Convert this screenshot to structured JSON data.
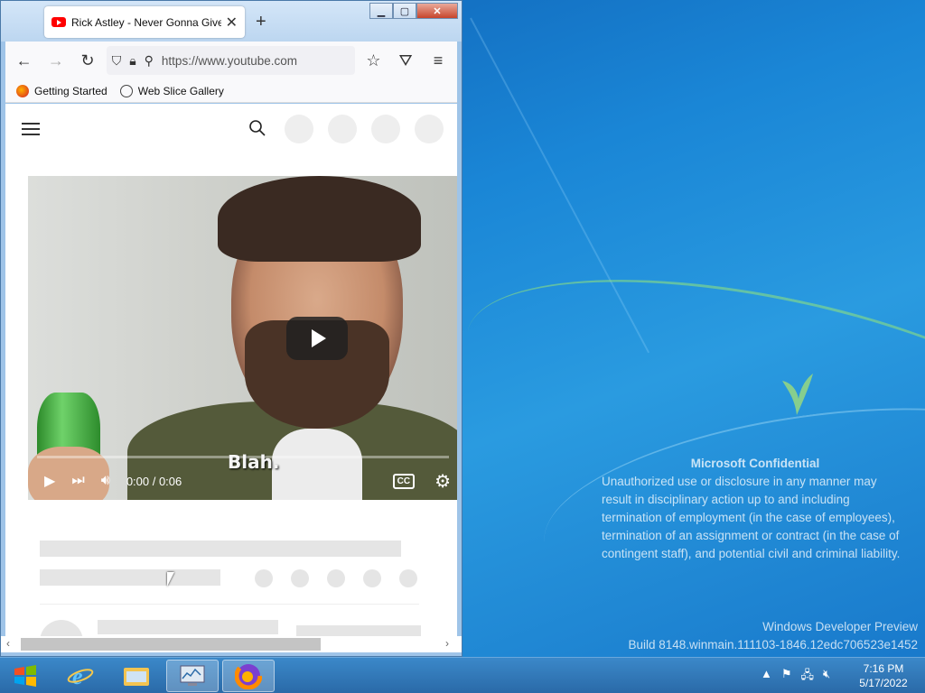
{
  "browser": {
    "tab_title": "Rick Astley - Never Gonna Give You Up",
    "new_tab_symbol": "+",
    "url": "https://www.youtube.com",
    "bookmarks": [
      {
        "label": "Getting Started",
        "icon": "firefox-icon"
      },
      {
        "label": "Web Slice Gallery",
        "icon": "globe-icon"
      }
    ]
  },
  "player": {
    "caption_text": "Blah.",
    "time": "0:00 / 0:06",
    "cc_label": "CC",
    "progress_fraction": 0
  },
  "desktop": {
    "watermark_title": "Microsoft Confidential",
    "watermark_body": "Unauthorized use or disclosure in any manner may result in disciplinary action up to and including termination of employment (in the case of employees), termination of an assignment or contract (in the case of contingent staff), and potential civil and criminal liability.",
    "build_line1": "Windows Developer Preview",
    "build_line2": "Build 8148.winmain.111103-1846.12edc706523e1452"
  },
  "taskbar": {
    "apps": [
      "internet-explorer",
      "file-explorer",
      "performance-monitor",
      "firefox"
    ],
    "active_app": "firefox",
    "time": "7:16 PM",
    "date": "5/17/2022"
  }
}
